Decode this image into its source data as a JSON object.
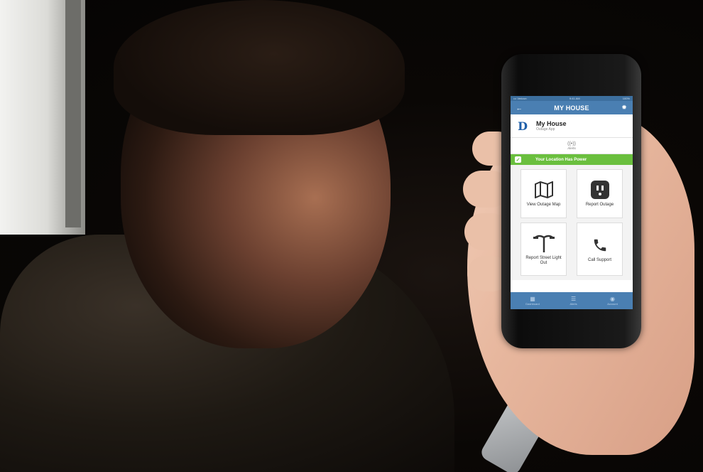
{
  "status_bar": {
    "carrier": "••• Verizon",
    "time": "9:41 AM",
    "battery": "100%"
  },
  "app": {
    "title": "MY HOUSE",
    "back_icon": "back-arrow-icon",
    "settings_icon": "gear-icon"
  },
  "house": {
    "logo_letter": "D",
    "name": "My House",
    "subtitle": "Outage App"
  },
  "alerts": {
    "label": "Alerts",
    "icon": "broadcast-icon"
  },
  "power_status": {
    "text": "Your Location Has Power",
    "color": "#6abf3e"
  },
  "tiles": [
    {
      "label": "View Outage Map",
      "icon": "map-icon"
    },
    {
      "label": "Report Outage",
      "icon": "outlet-icon"
    },
    {
      "label": "Report Street Light Out",
      "icon": "street-light-icon"
    },
    {
      "label": "Call Support",
      "icon": "phone-icon"
    }
  ],
  "tabbar": [
    {
      "label": "Dashboard",
      "icon": "grid-icon"
    },
    {
      "label": "Alerts",
      "icon": "list-icon"
    },
    {
      "label": "Account",
      "icon": "person-icon"
    }
  ],
  "colors": {
    "primary": "#4a7fb2",
    "success": "#6abf3e"
  }
}
